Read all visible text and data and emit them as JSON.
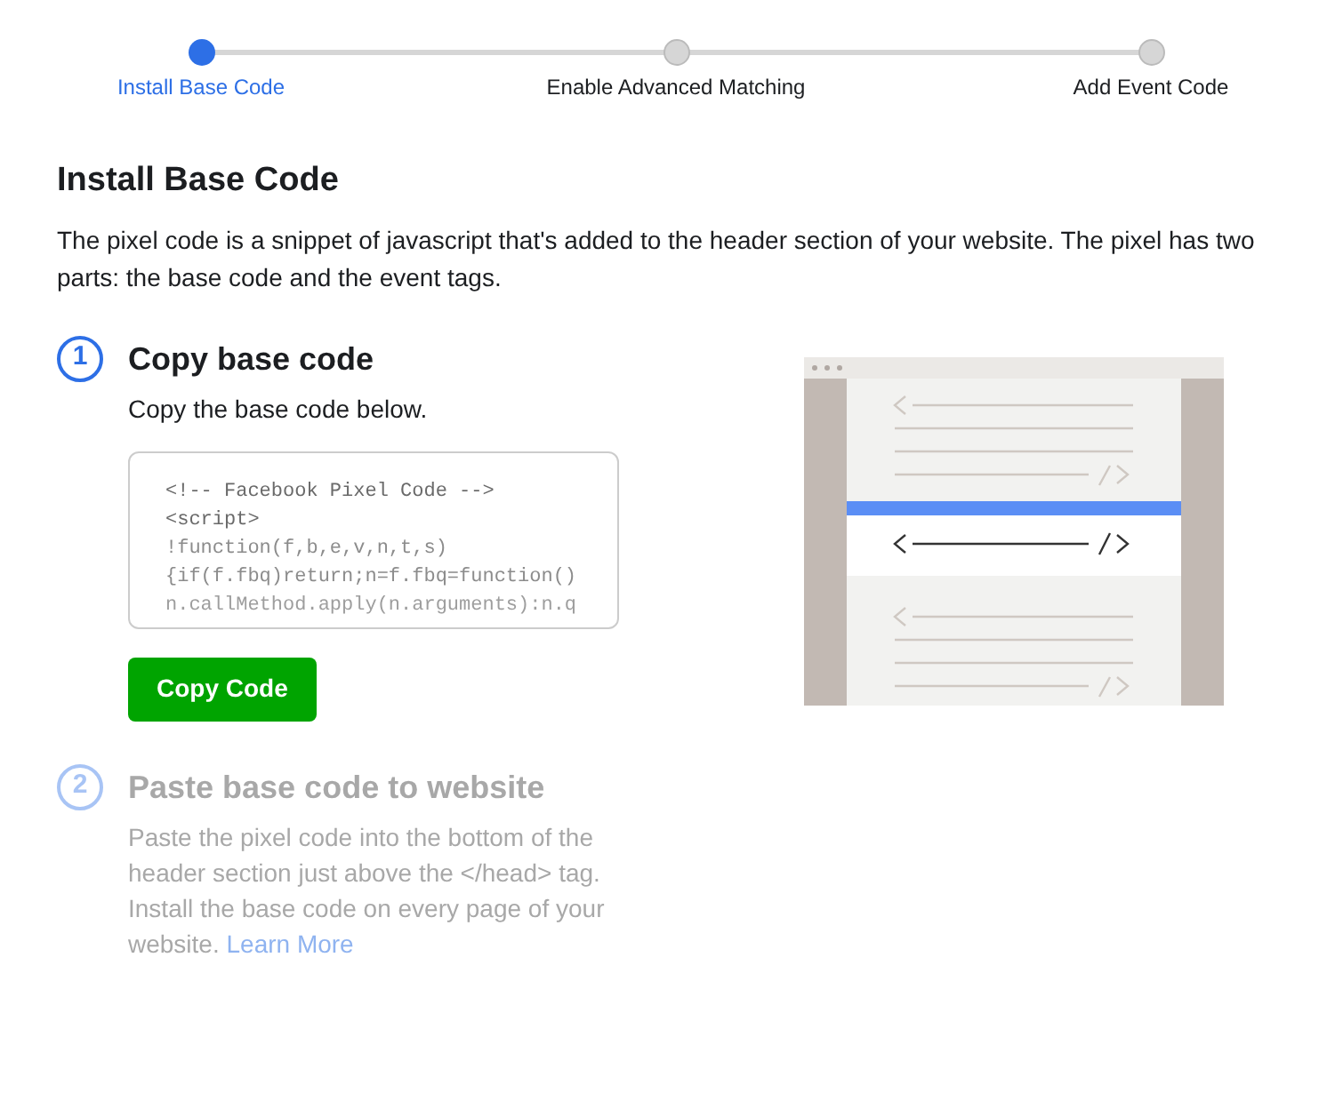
{
  "stepper": [
    {
      "label": "Install Base Code",
      "selected": true
    },
    {
      "label": "Enable Advanced Matching",
      "selected": false
    },
    {
      "label": "Add Event Code",
      "selected": false
    }
  ],
  "title": "Install Base Code",
  "description": "The pixel code is a snippet of javascript that's added to the header section of your website. The pixel has two parts: the base code and the event tags.",
  "steps": [
    {
      "number": "1",
      "title": "Copy base code",
      "active": true,
      "kind": "copy",
      "text": "Copy the base code below.",
      "code": [
        "<!-- Facebook Pixel Code -->",
        "<script>",
        "!function(f,b,e,v,n,t,s)",
        "{if(f.fbq)return;n=f.fbq=function()",
        "n.callMethod.apply(n.arguments):n.q"
      ],
      "button": "Copy Code"
    },
    {
      "number": "2",
      "title": "Paste base code to website",
      "active": false,
      "kind": "paste",
      "text": "Paste the pixel code into the bottom of the header section just above the </head> tag. Install the base code on every page of your website.",
      "link": "Learn More"
    }
  ]
}
